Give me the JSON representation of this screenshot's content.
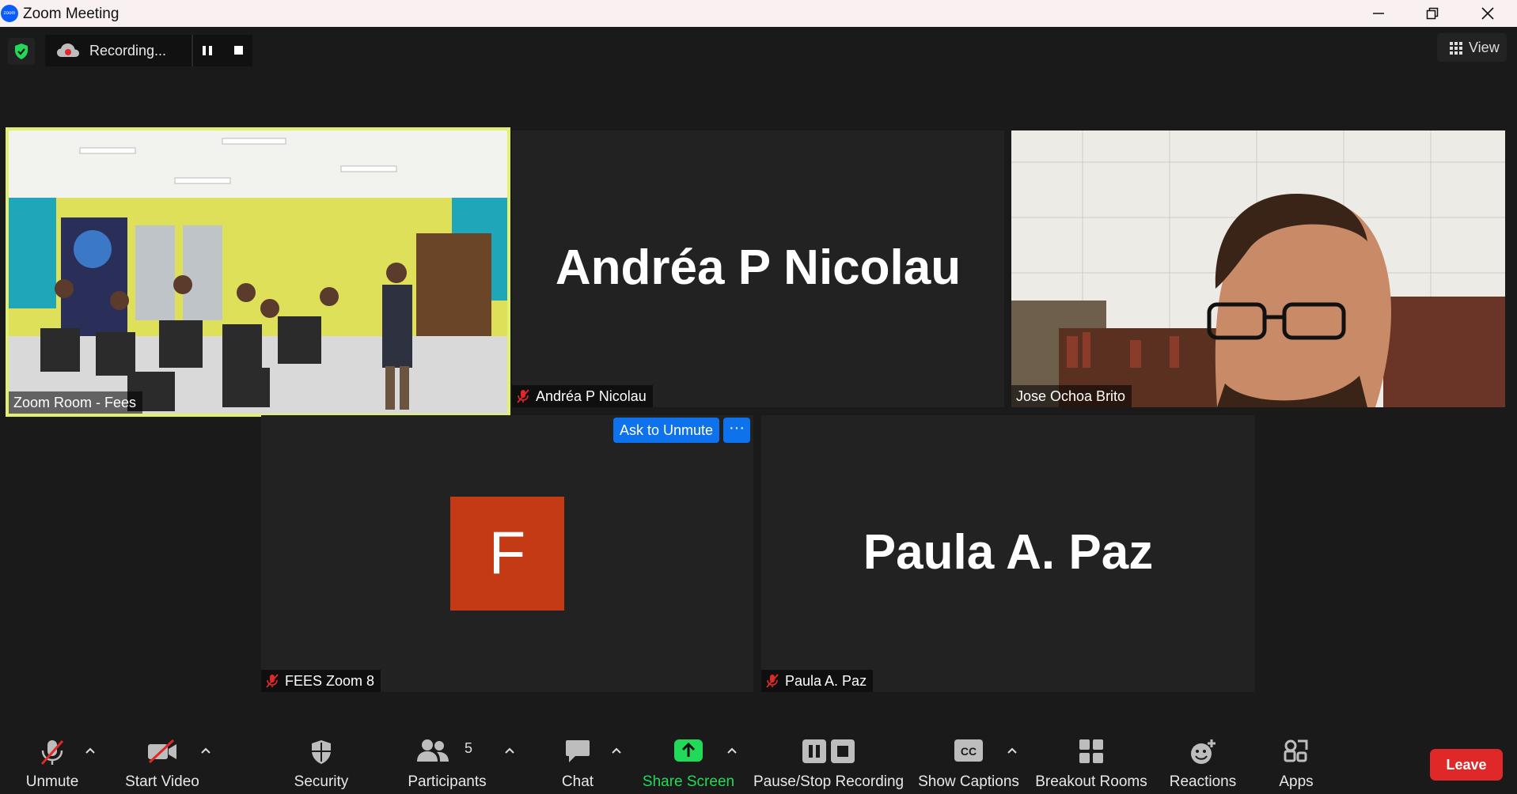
{
  "window": {
    "title": "Zoom Meeting",
    "logo_text": "zoom"
  },
  "recording": {
    "label": "Recording..."
  },
  "view_button": {
    "label": "View"
  },
  "tiles": [
    {
      "name": "Zoom Room - Fees",
      "type": "video-classroom",
      "active_speaker": true
    },
    {
      "name": "Andréa P Nicolau",
      "display_name": "Andréa P Nicolau",
      "type": "name-only",
      "muted": true
    },
    {
      "name": "Jose Ochoa Brito",
      "type": "video-person"
    },
    {
      "name": "FEES Zoom 8",
      "avatar_letter": "F",
      "type": "avatar",
      "muted": true
    },
    {
      "name": "Paula A. Paz",
      "display_name": "Paula A. Paz",
      "type": "name-only",
      "muted": true
    }
  ],
  "ask_to_unmute": {
    "label": "Ask to Unmute",
    "more": "···"
  },
  "toolbar": {
    "unmute": "Unmute",
    "start_video": "Start Video",
    "security": "Security",
    "participants": "Participants",
    "participants_count": "5",
    "chat": "Chat",
    "share_screen": "Share Screen",
    "pause_stop_recording": "Pause/Stop Recording",
    "show_captions": "Show Captions",
    "captions_icon_text": "CC",
    "breakout_rooms": "Breakout Rooms",
    "reactions": "Reactions",
    "apps": "Apps",
    "leave": "Leave"
  },
  "colors": {
    "active_border": "#e3ef6f",
    "accent_blue": "#0e72ed",
    "leave_red": "#e02828",
    "avatar_bg": "#c33a14",
    "share_green": "#23d959",
    "muted_red": "#e02828"
  }
}
